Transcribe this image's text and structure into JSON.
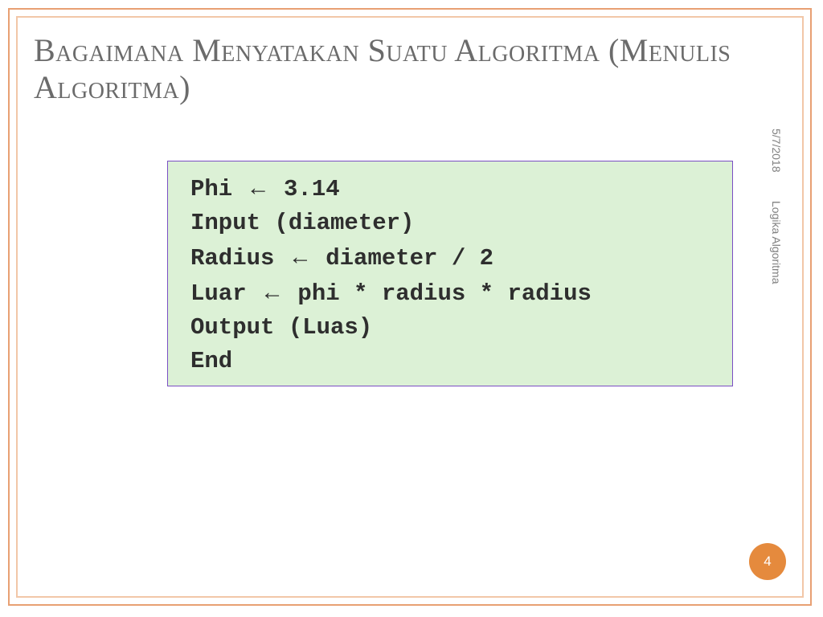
{
  "title": "Bagaimana Menyatakan Suatu Algoritma (Menulis Algoritma)",
  "code": {
    "line1_a": "Phi ",
    "line1_b": " 3.14",
    "line2": "Input (diameter)",
    "line3_a": "Radius ",
    "line3_b": " diameter / 2",
    "line4_a": "Luar ",
    "line4_b": " phi * radius * radius",
    "line5": "Output (Luas)",
    "line6": "End",
    "arrow": "←"
  },
  "meta": {
    "date": "5/7/2018",
    "subject": "Logika Algoritma"
  },
  "page_number": "4"
}
